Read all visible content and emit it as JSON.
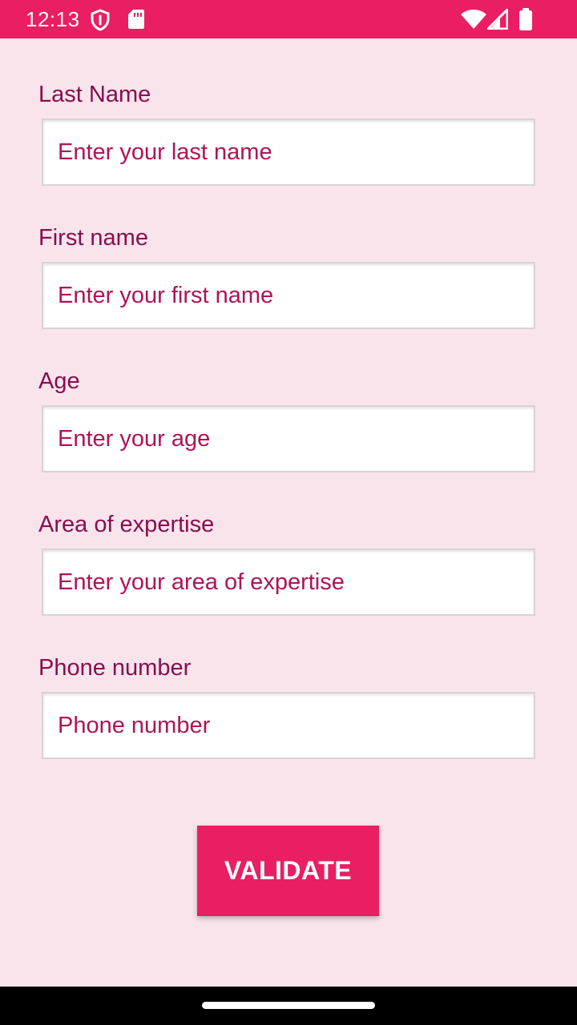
{
  "status_bar": {
    "time": "12:13",
    "background": "#e91e63",
    "icons": [
      "shield-icon",
      "sim-card-icon",
      "wifi-icon",
      "cell-signal-icon",
      "battery-icon"
    ]
  },
  "form": {
    "fields": [
      {
        "label": "Last Name",
        "placeholder": "Enter your last name"
      },
      {
        "label": "First name",
        "placeholder": "Enter your first name"
      },
      {
        "label": "Age",
        "placeholder": "Enter your age"
      },
      {
        "label": "Area of expertise",
        "placeholder": "Enter your area of expertise"
      },
      {
        "label": "Phone number",
        "placeholder": "Phone number"
      }
    ],
    "validate_label": "VALIDATE"
  },
  "colors": {
    "accent": "#e91e63",
    "background": "#fae4ec",
    "label_text": "#880e4f",
    "placeholder_text": "#ad1457"
  }
}
